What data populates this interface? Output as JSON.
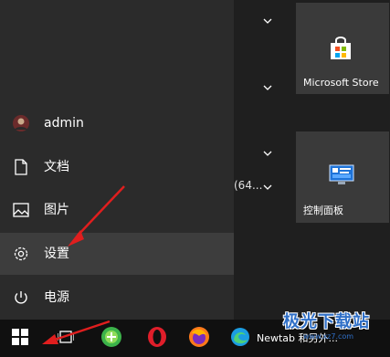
{
  "start_menu": {
    "items": [
      {
        "label": "admin",
        "icon": "user-avatar-icon"
      },
      {
        "label": "文档",
        "icon": "document-icon"
      },
      {
        "label": "图片",
        "icon": "pictures-icon"
      },
      {
        "label": "设置",
        "icon": "gear-icon",
        "active": true
      },
      {
        "label": "电源",
        "icon": "power-icon"
      }
    ],
    "partial_text": "(64..."
  },
  "tiles": [
    {
      "label": "Microsoft Store",
      "icon": "store-icon"
    },
    {
      "label": "控制面板",
      "icon": "control-panel-icon"
    }
  ],
  "taskbar": {
    "apps": [
      {
        "name": "start-button",
        "icon": "windows-logo-icon"
      },
      {
        "name": "task-view",
        "icon": "task-view-icon"
      },
      {
        "name": "green-browser",
        "icon": "green-browser-icon"
      },
      {
        "name": "opera",
        "icon": "opera-icon"
      },
      {
        "name": "firefox",
        "icon": "firefox-icon"
      },
      {
        "name": "edge",
        "icon": "edge-icon"
      }
    ],
    "active_window_label": "Newtab 和另外..."
  },
  "watermark": {
    "text": "极光下载站",
    "subtext": "www.xz7.com"
  },
  "colors": {
    "rail": "#2b2b2b",
    "active": "#3d3d3d",
    "taskbar": "#101010",
    "annotation_arrow": "#e01e1e"
  }
}
